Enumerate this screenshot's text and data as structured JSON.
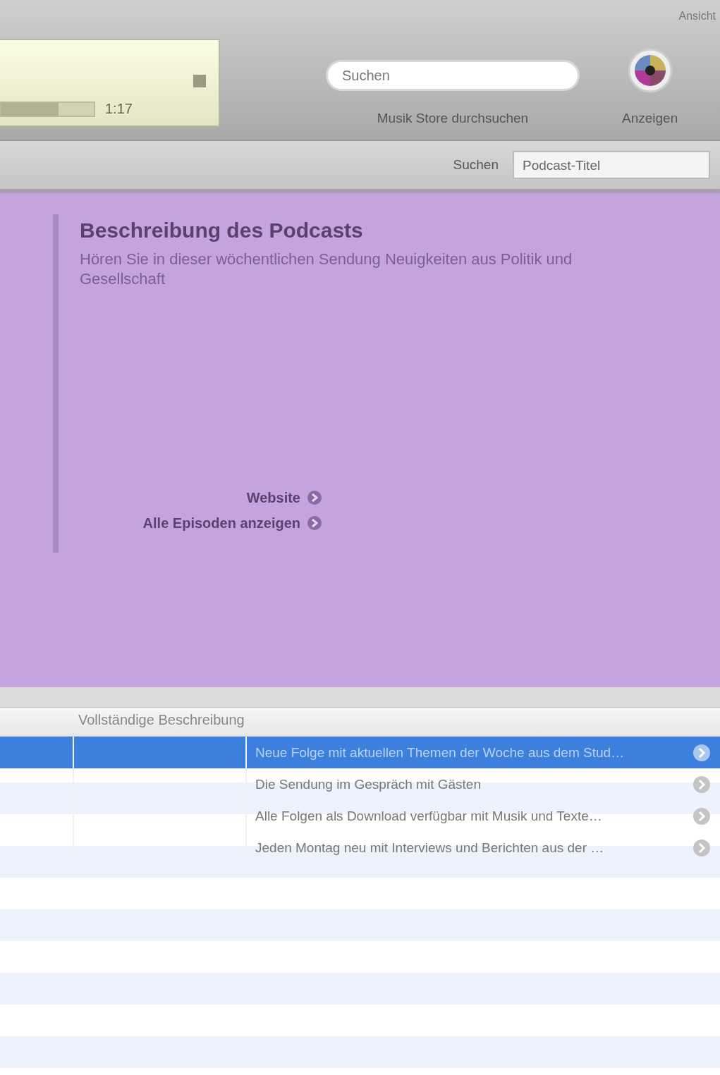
{
  "toolbar": {
    "lcd": {
      "time": "1:17",
      "level": 0.62
    },
    "search": {
      "placeholder": "Suchen",
      "caption": "Musik Store durchsuchen"
    },
    "browse": {
      "caption": "Anzeigen"
    },
    "corner_label": "Ansicht"
  },
  "filter_bar": {
    "label": "Suchen",
    "field_value": "Podcast-Titel"
  },
  "info": {
    "title": "Beschreibung des Podcasts",
    "description": "Hören Sie in dieser wöchentlichen Sendung Neuigkeiten aus Politik und Gesellschaft",
    "links": [
      "Website",
      "Alle Episoden anzeigen"
    ]
  },
  "list": {
    "column": "Vollständige Beschreibung",
    "rows": [
      {
        "text": "Neue Folge mit aktuellen Themen der Woche aus dem Stud…",
        "selected": true
      },
      {
        "text": "Die Sendung im Gespräch mit Gästen",
        "selected": false
      },
      {
        "text": "Alle Folgen als Download verfügbar mit Musik und Texte…",
        "selected": false
      },
      {
        "text": "Jeden Montag neu mit Interviews und Berichten aus der …",
        "selected": false
      }
    ]
  }
}
